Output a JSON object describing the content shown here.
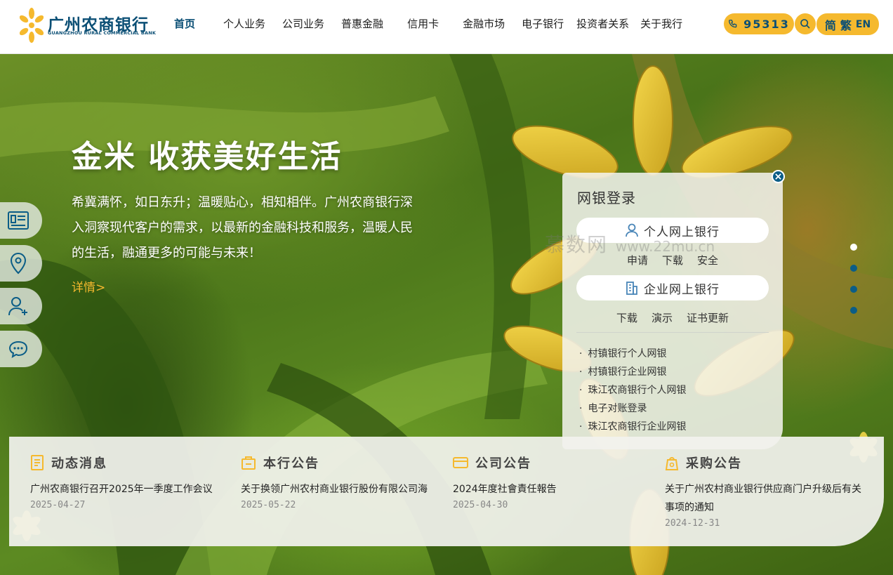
{
  "brand": {
    "name_cn": "广州农商银行",
    "name_en": "GUANGZHOU RURAL COMMERCIAL BANK",
    "primary_color": "#0b4f75",
    "accent_color": "#f5b92e"
  },
  "nav": {
    "items": [
      "首页",
      "个人业务",
      "公司业务",
      "普惠金融",
      "信用卡",
      "金融市场",
      "电子银行",
      "投资者关系",
      "关于我行"
    ],
    "active_index": 0
  },
  "header_tools": {
    "hotline": "95313",
    "hotline_icon": "phone-icon",
    "search_icon": "search-icon",
    "lang_simplified": "简",
    "lang_traditional": "繁",
    "lang_english": "EN"
  },
  "hero": {
    "title": "金米 收获美好生活",
    "description": "希冀满怀，如日东升；温暖贴心，相知相伴。广州农商银行深入洞察现代客户的需求，以最新的金融科技和服务，温暖人民的生活，融通更多的可能与未来！",
    "more": "详情>"
  },
  "side_tools": [
    {
      "icon": "news-card-icon"
    },
    {
      "icon": "location-pin-icon"
    },
    {
      "icon": "user-add-icon"
    },
    {
      "icon": "chat-icon"
    }
  ],
  "login": {
    "title": "网银登录",
    "personal": {
      "label": "个人网上银行",
      "icon": "user-icon",
      "links": [
        "申请",
        "下载",
        "安全"
      ]
    },
    "corporate": {
      "label": "企业网上银行",
      "icon": "building-icon",
      "links": [
        "下载",
        "演示",
        "证书更新"
      ]
    },
    "list": [
      "村镇银行个人网银",
      "村镇银行企业网银",
      "珠江农商银行个人网银",
      "电子对账登录",
      "珠江农商银行企业网银"
    ]
  },
  "watermark": {
    "text": "慕数网",
    "url": "www.22mu.cn"
  },
  "carousel": {
    "count": 4,
    "active_index": 0
  },
  "news": [
    {
      "heading": "动态消息",
      "icon": "document-icon",
      "title": "广州农商银行召开2025年一季度工作会议",
      "date": "2025-04-27"
    },
    {
      "heading": "本行公告",
      "icon": "notice-bag-icon",
      "title": "关于换领广州农村商业银行股份有限公司海",
      "date": "2025-05-22"
    },
    {
      "heading": "公司公告",
      "icon": "card-icon",
      "title": "2024年度社會責任報告",
      "date": "2025-04-30"
    },
    {
      "heading": "采购公告",
      "icon": "bag-icon",
      "title": "关于广州农村商业银行供应商门户升级后有关事项的通知",
      "date": "2024-12-31"
    }
  ]
}
